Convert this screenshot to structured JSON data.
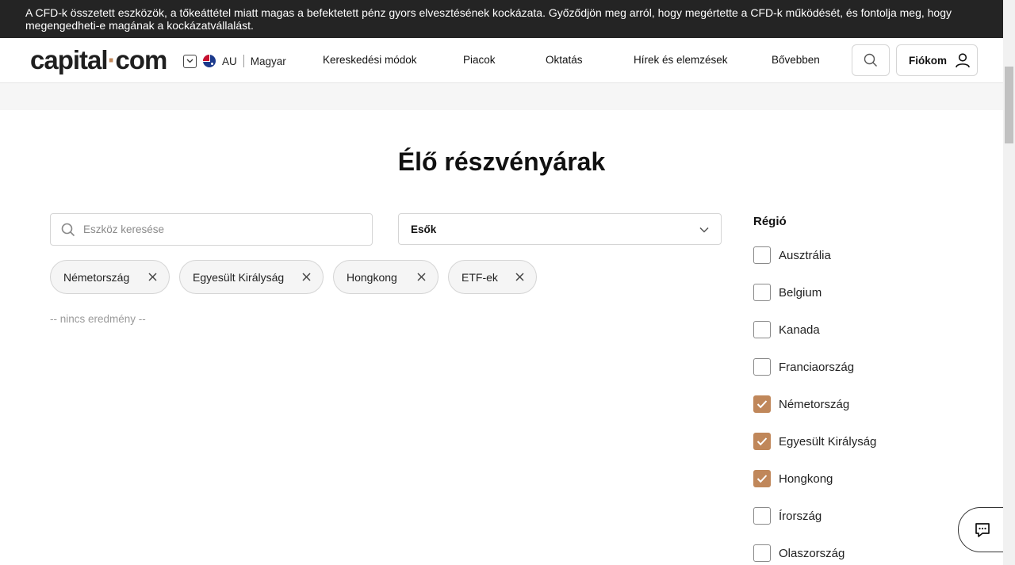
{
  "banner": {
    "text": "A CFD-k összetett eszközök, a tőkeáttétel miatt magas a befektetett pénz gyors elvesztésének kockázata. Győződjön meg arról, hogy megértette a CFD-k működését, és fontolja meg, hogy megengedheti-e magának a kockázatvállalást."
  },
  "header": {
    "logo_left": "capital",
    "logo_dot": "·",
    "logo_right": "com",
    "region_code": "AU",
    "language": "Magyar",
    "nav": [
      "Kereskedési módok",
      "Piacok",
      "Oktatás",
      "Hírek és elemzések",
      "Bővebben"
    ],
    "account_label": "Fiókom"
  },
  "page": {
    "title": "Élő részvényárak"
  },
  "search": {
    "placeholder": "Eszköz keresése"
  },
  "sort": {
    "selected": "Esők"
  },
  "chips": [
    "Németország",
    "Egyesült Királyság",
    "Hongkong",
    "ETF-ek"
  ],
  "results": {
    "empty_text": "-- nincs eredmény --"
  },
  "region": {
    "title": "Régió",
    "items": [
      {
        "label": "Ausztrália",
        "checked": false
      },
      {
        "label": "Belgium",
        "checked": false
      },
      {
        "label": "Kanada",
        "checked": false
      },
      {
        "label": "Franciaország",
        "checked": false
      },
      {
        "label": "Németország",
        "checked": true
      },
      {
        "label": "Egyesült Királyság",
        "checked": true
      },
      {
        "label": "Hongkong",
        "checked": true
      },
      {
        "label": "Írország",
        "checked": false
      },
      {
        "label": "Olaszország",
        "checked": false
      }
    ]
  },
  "colors": {
    "accent": "#c0875a",
    "banner_bg": "#242424"
  }
}
